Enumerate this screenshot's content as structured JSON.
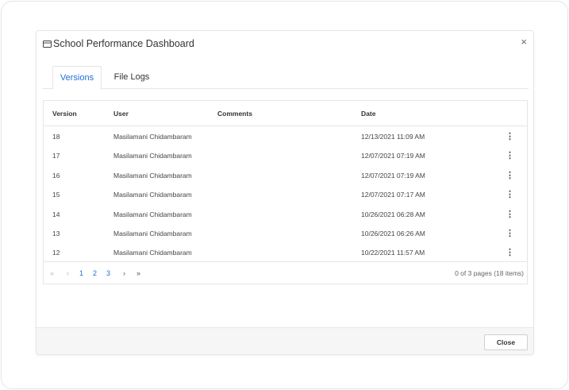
{
  "dialog": {
    "title": "School Performance Dashboard",
    "title_icon": "window-icon",
    "close_icon": "close-icon",
    "close_glyph": "×"
  },
  "tabs": [
    {
      "label": "Versions",
      "active": true
    },
    {
      "label": "File Logs",
      "active": false
    }
  ],
  "grid": {
    "columns": [
      "Version",
      "User",
      "Comments",
      "Date"
    ],
    "rows": [
      {
        "version": "18",
        "user": "Masilamani Chidambaram",
        "comments": "",
        "date": "12/13/2021 11:09 AM"
      },
      {
        "version": "17",
        "user": "Masilamani Chidambaram",
        "comments": "",
        "date": "12/07/2021 07:19 AM"
      },
      {
        "version": "16",
        "user": "Masilamani Chidambaram",
        "comments": "",
        "date": "12/07/2021 07:19 AM"
      },
      {
        "version": "15",
        "user": "Masilamani Chidambaram",
        "comments": "",
        "date": "12/07/2021 07:17 AM"
      },
      {
        "version": "14",
        "user": "Masilamani Chidambaram",
        "comments": "",
        "date": "10/26/2021 06:28 AM"
      },
      {
        "version": "13",
        "user": "Masilamani Chidambaram",
        "comments": "",
        "date": "10/26/2021 06:26 AM"
      },
      {
        "version": "12",
        "user": "Masilamani Chidambaram",
        "comments": "",
        "date": "10/22/2021 11:57 AM"
      }
    ],
    "row_menu_glyph": "⋮"
  },
  "pager": {
    "first": "«",
    "prev": "‹",
    "pages": [
      "1",
      "2",
      "3"
    ],
    "next": "›",
    "last": "»",
    "info": "0 of 3 pages (18 items)"
  },
  "footer": {
    "close_label": "Close"
  },
  "colors": {
    "accent": "#1e6fd9",
    "border": "#e6e6e6",
    "footer_bg": "#f6f6f6"
  }
}
